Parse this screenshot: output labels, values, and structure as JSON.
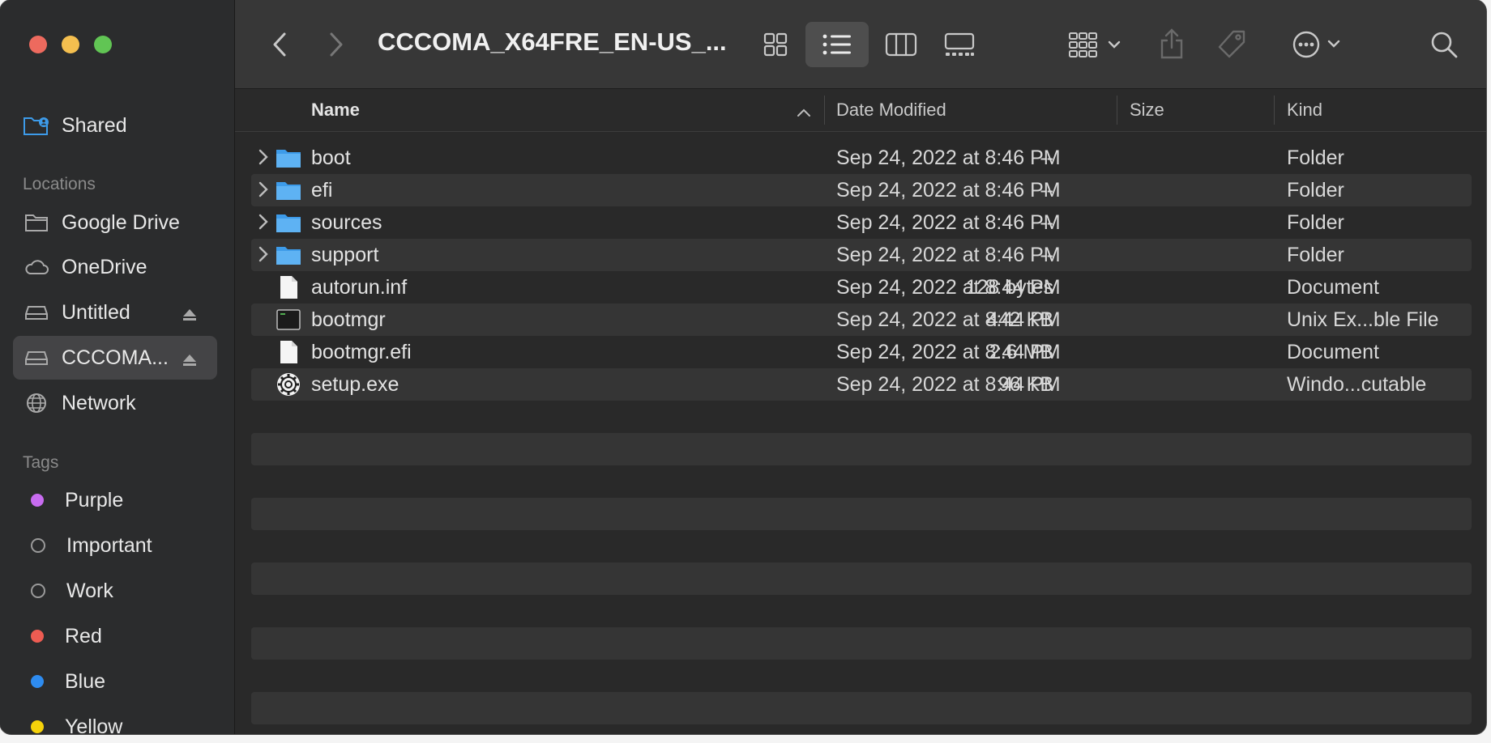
{
  "window": {
    "title": "CCCOMA_X64FRE_EN-US_..."
  },
  "sidebar": {
    "favorites": [
      {
        "label": "Shared",
        "icon": "shared-folder-icon"
      }
    ],
    "locations_header": "Locations",
    "locations": [
      {
        "label": "Google Drive",
        "icon": "folder-icon"
      },
      {
        "label": "OneDrive",
        "icon": "cloud-icon"
      },
      {
        "label": "Untitled",
        "icon": "drive-icon",
        "eject": true
      },
      {
        "label": "CCCOMA...",
        "icon": "drive-icon",
        "eject": true,
        "selected": true
      },
      {
        "label": "Network",
        "icon": "globe-icon"
      }
    ],
    "tags_header": "Tags",
    "tags": [
      {
        "label": "Purple",
        "color": "#c86cf0"
      },
      {
        "label": "Important",
        "color": null
      },
      {
        "label": "Work",
        "color": null
      },
      {
        "label": "Red",
        "color": "#ee5c52"
      },
      {
        "label": "Blue",
        "color": "#2e8cf0"
      },
      {
        "label": "Yellow",
        "color": "#f5d20a"
      }
    ]
  },
  "columns": {
    "name": "Name",
    "date": "Date Modified",
    "size": "Size",
    "kind": "Kind"
  },
  "files": [
    {
      "name": "boot",
      "date": "Sep 24, 2022 at 8:46 PM",
      "size": "--",
      "kind": "Folder",
      "type": "folder"
    },
    {
      "name": "efi",
      "date": "Sep 24, 2022 at 8:46 PM",
      "size": "--",
      "kind": "Folder",
      "type": "folder"
    },
    {
      "name": "sources",
      "date": "Sep 24, 2022 at 8:46 PM",
      "size": "--",
      "kind": "Folder",
      "type": "folder"
    },
    {
      "name": "support",
      "date": "Sep 24, 2022 at 8:46 PM",
      "size": "--",
      "kind": "Folder",
      "type": "folder"
    },
    {
      "name": "autorun.inf",
      "date": "Sep 24, 2022 at 8:44 PM",
      "size": "128 bytes",
      "kind": "Document",
      "type": "document"
    },
    {
      "name": "bootmgr",
      "date": "Sep 24, 2022 at 8:44 PM",
      "size": "442 KB",
      "kind": "Unix Ex...ble File",
      "type": "executable"
    },
    {
      "name": "bootmgr.efi",
      "date": "Sep 24, 2022 at 8:44 PM",
      "size": "2.6 MB",
      "kind": "Document",
      "type": "document"
    },
    {
      "name": "setup.exe",
      "date": "Sep 24, 2022 at 8:44 PM",
      "size": "96 KB",
      "kind": "Windo...cutable",
      "type": "app"
    }
  ],
  "colors": {
    "accent": "#3d9be9",
    "window_bg": "#292929",
    "sidebar_bg": "#2b2c2d"
  }
}
